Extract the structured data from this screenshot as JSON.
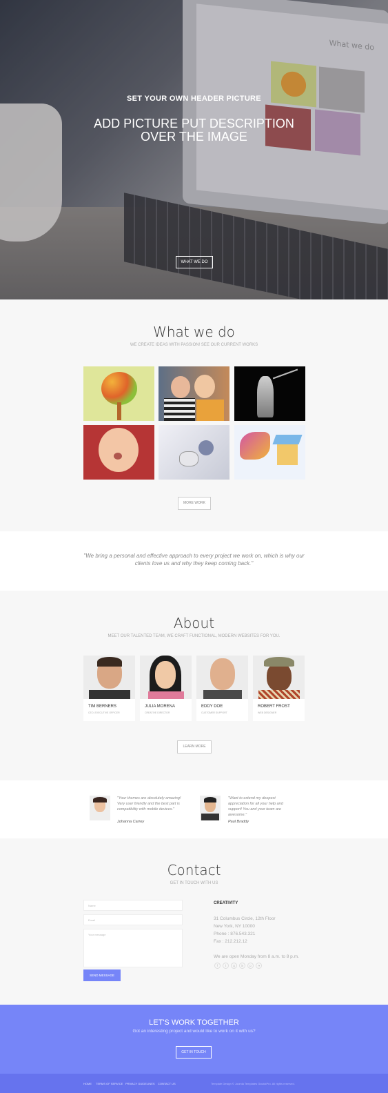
{
  "hero": {
    "subtitle": "SET YOUR OWN HEADER PICTURE",
    "title_line1": "ADD PICTURE PUT DESCRIPTION",
    "title_line2": "OVER THE IMAGE",
    "button": "WHAT WE DO",
    "screen_title": "What we do"
  },
  "work": {
    "title": "What we do",
    "tagline": "WE CREATE IDEAS WITH PASSION! SEE OUR CURRENT WORKS",
    "button": "MORE WORK"
  },
  "quote": {
    "text": "\"We bring a personal and effective approach to every project we work on, which is why our clients love us and why they keep coming back.\""
  },
  "about": {
    "title": "About",
    "tagline": "MEET OUR TALENTED TEAM, WE CRAFT FUNCTIONAL, MODERN WEBSITES FOR YOU.",
    "button": "LEARN MORE",
    "team": [
      {
        "name": "TIM BERNERS",
        "role": "CEO, EXECUTIVE OFFICER"
      },
      {
        "name": "JULIA MORENA",
        "role": "CREATIVE DIRECTOR"
      },
      {
        "name": "EDDY DOE",
        "role": "CUSTOMER SUPPORT"
      },
      {
        "name": "ROBERT FROST",
        "role": "WEB DESIGNER"
      }
    ]
  },
  "testimonials": [
    {
      "quote": "\"Your themes are absolutely amazing! Very user friendly and the best part is compatibility with mobile devices.\"",
      "name": "Johanna Carrey"
    },
    {
      "quote": "\"Want to extend my deepest appreciation for all your help and support! You and your team are awesome.\"",
      "name": "Paul Braddy"
    }
  ],
  "contact": {
    "title": "Contact",
    "tagline": "GET IN TOUCH WITH US",
    "name_placeholder": "Name",
    "email_placeholder": "Email",
    "message_placeholder": "Your message",
    "send": "SEND MESSAGE",
    "company": "CREATIVITY",
    "address1": "31 Columbus Circle, 12th Floor",
    "address2": "New York, NY 10000",
    "phone": "Phone : 876.543.321",
    "fax": "Fax : 212.212.12",
    "hours": "We are open Monday from 8 a.m. to 8 p.m."
  },
  "cta": {
    "title": "LET'S WORK TOGETHER",
    "subtitle": "Got an interesting project and would like to work on it with us?",
    "button": "GET IN TOUCH"
  },
  "footer": {
    "links": [
      "HOME",
      "TERMS OF SERVICE",
      "PRIVACY GUIDELINES",
      "CONTACT US"
    ],
    "copyright": "Template Design © Joomla Templates GavickPro. All rights reserved."
  },
  "colors": {
    "accent": "#7685f8",
    "footer": "#6673ee"
  },
  "social_icons": [
    "facebook-icon",
    "twitter-icon",
    "google-plus-icon",
    "linkedin-icon",
    "pinterest-icon",
    "rss-icon"
  ]
}
